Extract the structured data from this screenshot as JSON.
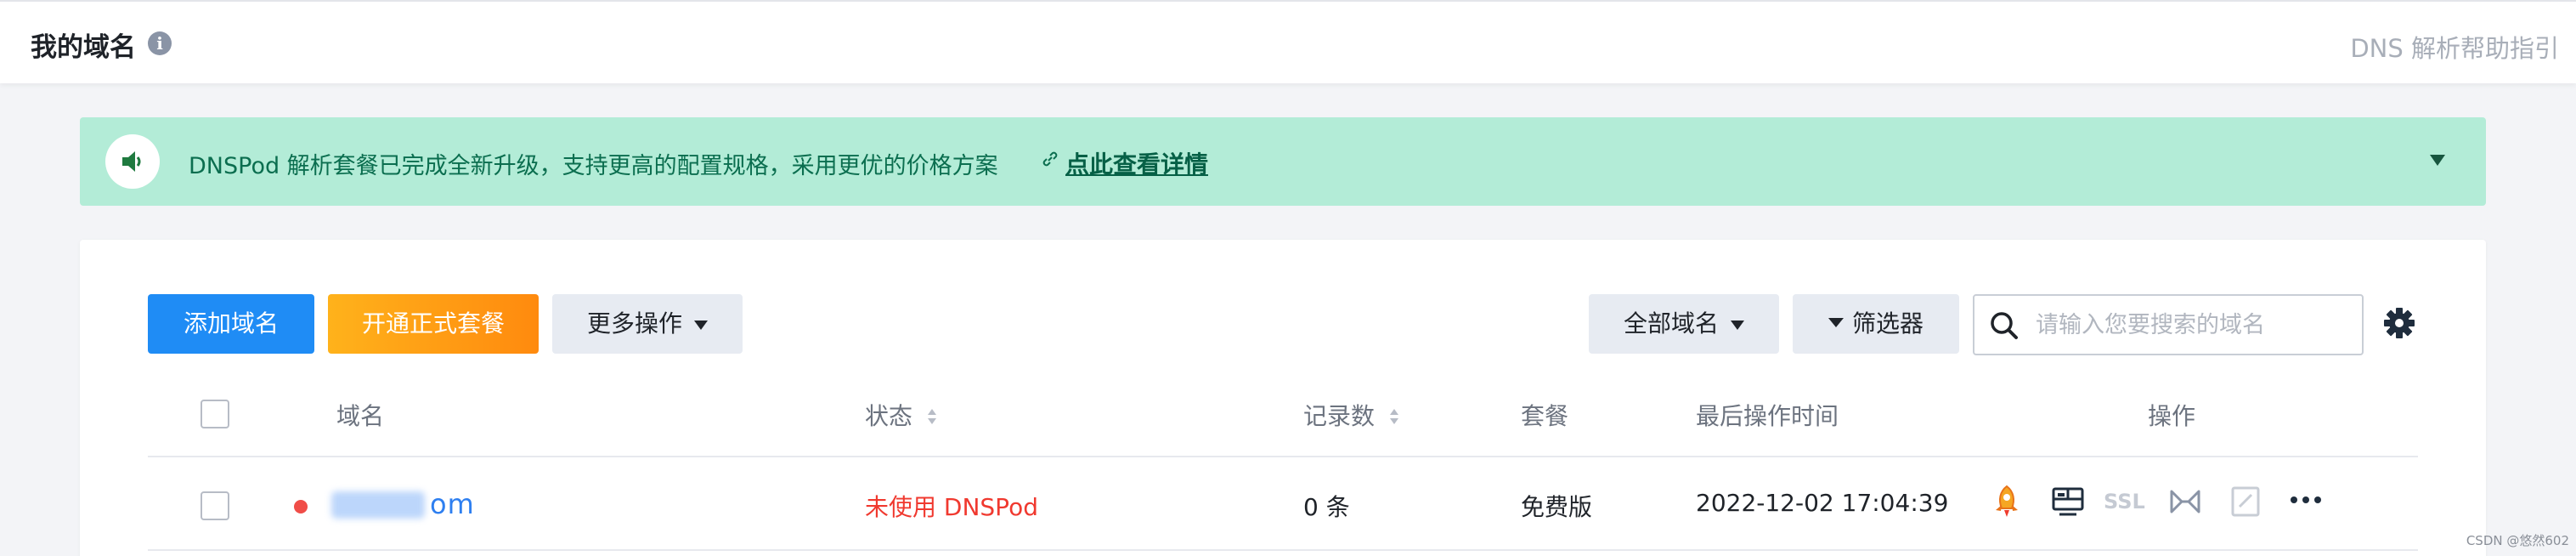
{
  "header": {
    "title": "我的域名",
    "help_link": "DNS 解析帮助指引"
  },
  "banner": {
    "message": "DNSPod 解析套餐已完成全新升级，支持更高的配置规格，采用更优的价格方案",
    "link_text": "点此查看详情",
    "bg_color": "#b3ecd7"
  },
  "toolbar": {
    "add_domain": "添加域名",
    "open_plan": "开通正式套餐",
    "more_actions": "更多操作",
    "all_domains": "全部域名",
    "filter": "筛选器",
    "search_placeholder": "请输入您要搜索的域名"
  },
  "table": {
    "columns": [
      "域名",
      "状态",
      "记录数",
      "套餐",
      "最后操作时间",
      "操作"
    ],
    "rows": [
      {
        "domain": "om",
        "status": "未使用 DNSPod",
        "records": "0 条",
        "plan": "免费版",
        "last_modified": "2022-12-02 17:04:39",
        "actions": [
          "rocket-icon",
          "monitor-icon",
          "ssl-icon",
          "link-icon",
          "edit-icon",
          "more-icon"
        ],
        "ssl_label": "SSL"
      }
    ]
  },
  "watermark": "CSDN @悠然602",
  "colors": {
    "primary": "#1f8cf5",
    "accent_orange": "#ff8a0e",
    "status_red": "#f0392f"
  }
}
